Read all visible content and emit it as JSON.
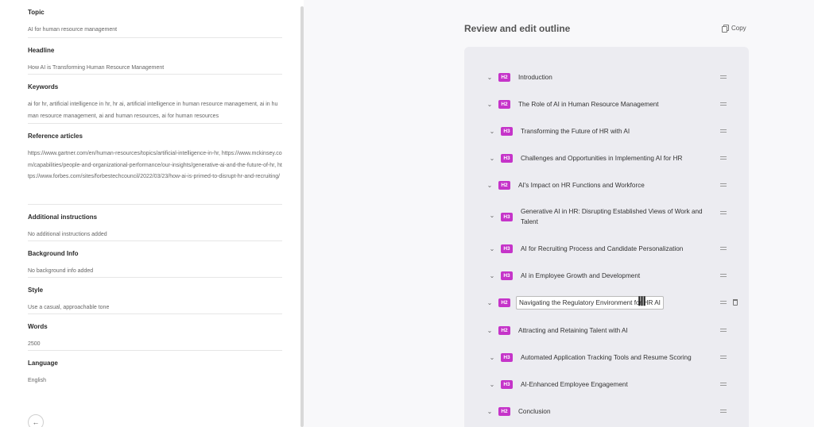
{
  "left": {
    "sections": [
      {
        "label": "Topic",
        "value": "AI for human resource management"
      },
      {
        "label": "Headline",
        "value": "How AI is Transforming Human Resource Management"
      },
      {
        "label": "Keywords",
        "value": "ai for hr, artificial intelligence in hr, hr ai, artificial intelligence in human resource management, ai in human resource management, ai and human resources, ai for human resources"
      },
      {
        "label": "Reference articles",
        "value": "https://www.gartner.com/en/human-resources/topics/artificial-intelligence-in-hr, https://www.mckinsey.com/capabilities/people-and-organizational-performance/our-insights/generative-ai-and-the-future-of-hr, https://www.forbes.com/sites/forbestechcouncil/2022/03/23/how-ai-is-primed-to-disrupt-hr-and-recruiting/"
      },
      {
        "label": "Additional instructions",
        "value": "No additional instructions added"
      },
      {
        "label": "Background Info",
        "value": "No background info added"
      },
      {
        "label": "Style",
        "value": "Use a casual, approachable tone"
      },
      {
        "label": "Words",
        "value": "2500"
      },
      {
        "label": "Language",
        "value": "English"
      }
    ],
    "back_icon": "arrow-left-icon"
  },
  "right": {
    "title": "Review and edit outline",
    "copy_label": "Copy",
    "outline": [
      {
        "level": "H2",
        "text": "Introduction"
      },
      {
        "level": "H2",
        "text": "The Role of AI in Human Resource Management"
      },
      {
        "level": "H3",
        "text": "Transforming the Future of HR with AI"
      },
      {
        "level": "H3",
        "text": "Challenges and Opportunities in Implementing AI for HR"
      },
      {
        "level": "H2",
        "text": "AI's Impact on HR Functions and Workforce"
      },
      {
        "level": "H3",
        "text": "Generative AI in HR: Disrupting Established Views of Work and Talent"
      },
      {
        "level": "H3",
        "text": "AI for Recruiting Process and Candidate Personalization"
      },
      {
        "level": "H3",
        "text": "AI in Employee Growth and Development"
      },
      {
        "level": "H2",
        "text": "Navigating the Regulatory Environment for HR AI"
      },
      {
        "level": "H2",
        "text": "Attracting and Retaining Talent with AI"
      },
      {
        "level": "H3",
        "text": "Automated Application Tracking Tools and Resume Scoring"
      },
      {
        "level": "H3",
        "text": "AI-Enhanced Employee Engagement"
      },
      {
        "level": "H2",
        "text": "Conclusion"
      }
    ]
  },
  "colors": {
    "badge": "#c534c9",
    "panel_bg": "#f8f8fa",
    "outline_bg": "#ececf1"
  }
}
